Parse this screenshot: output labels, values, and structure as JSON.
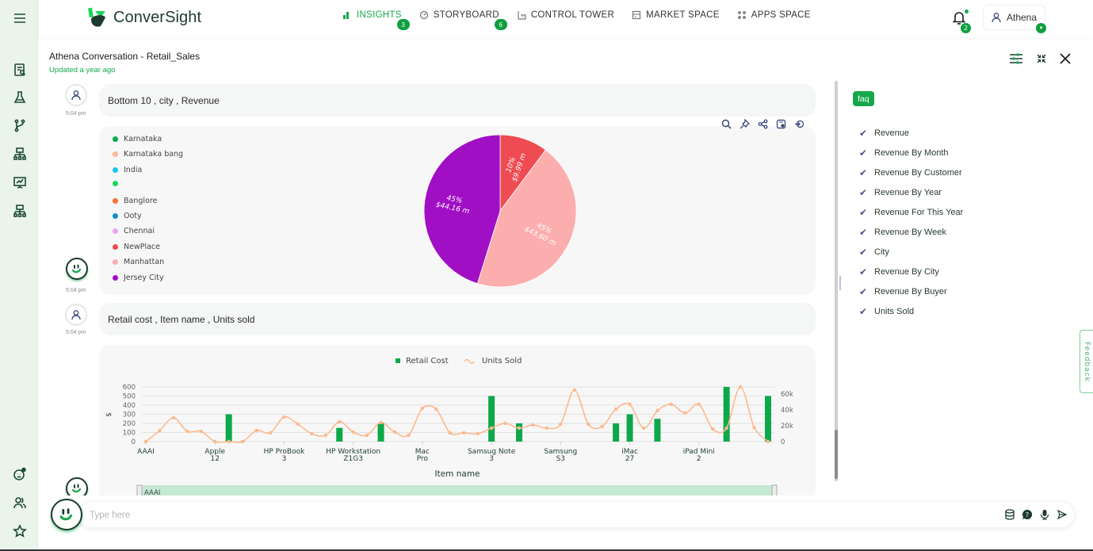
{
  "app": {
    "brand": "ConverSight",
    "brand_colors": {
      "primary": "#14a84b",
      "dark": "#1d3b2e"
    }
  },
  "nav": [
    {
      "label": "INSIGHTS",
      "icon": "bar-chart-icon",
      "badge": "3",
      "active": true
    },
    {
      "label": "STORYBOARD",
      "icon": "gauge-icon",
      "badge": "6",
      "active": false
    },
    {
      "label": "CONTROL TOWER",
      "icon": "tower-icon",
      "badge": null,
      "active": false
    },
    {
      "label": "MARKET SPACE",
      "icon": "store-icon",
      "badge": null,
      "active": false
    },
    {
      "label": "APPS SPACE",
      "icon": "apps-grid-icon",
      "badge": null,
      "active": false
    }
  ],
  "notifications": {
    "count": "2"
  },
  "user": {
    "name": "Athena"
  },
  "sidebar": {
    "top_icons": [
      "report-search-icon",
      "flask-icon",
      "branch-icon",
      "hierarchy-icon",
      "presentation-chart-icon",
      "org-chart-icon"
    ],
    "bottom_icons": [
      "bot-settings-icon",
      "users-icon",
      "star-icon"
    ]
  },
  "conversation": {
    "title": "Athena Conversation - Retail_Sales",
    "updated": "Updated a year ago"
  },
  "messages": [
    {
      "type": "user",
      "text": "Bottom 10 , city , Revenue",
      "time": "5:04 pm"
    },
    {
      "type": "bot",
      "time": "5:04 pm",
      "chart": "pie"
    },
    {
      "type": "user",
      "text": "Retail cost , Item name , Units sold",
      "time": "5:04 pm"
    },
    {
      "type": "bot",
      "time": "",
      "chart": "combo"
    }
  ],
  "chart_tools": [
    "search-icon",
    "pin-icon",
    "share-icon",
    "save-icon",
    "export-icon"
  ],
  "chart_data": [
    {
      "type": "pie",
      "title": "Bottom 10, city, Revenue",
      "legend_position": "left",
      "legend": [
        {
          "label": "Karnataka",
          "color": "#0da849"
        },
        {
          "label": "Karnataka bang",
          "color": "#fdb98f"
        },
        {
          "label": "India",
          "color": "#1cc2f5"
        },
        {
          "label": "",
          "color": "#18d858"
        },
        {
          "label": "Banglore",
          "color": "#fb7230"
        },
        {
          "label": "Ooty",
          "color": "#0a94c8"
        },
        {
          "label": "Chennai",
          "color": "#eda3f3"
        },
        {
          "label": "NewPlace",
          "color": "#ef4b52"
        },
        {
          "label": "Manhattan",
          "color": "#fbaead"
        },
        {
          "label": "Jersey City",
          "color": "#a00fc4"
        }
      ],
      "slices": [
        {
          "label": "NewPlace",
          "value": 9.99,
          "percent": "10%",
          "value_label": "$9.99 m",
          "color": "#ef4b52"
        },
        {
          "label": "Manhattan",
          "value": 43.6,
          "percent": "45%",
          "value_label": "$43.60 m",
          "color": "#fbaead"
        },
        {
          "label": "Jersey City",
          "value": 44.16,
          "percent": "45%",
          "value_label": "$44.16 m",
          "color": "#a00fc4"
        }
      ]
    },
    {
      "type": "bar",
      "subtype": "bar+line",
      "xlabel": "Item name",
      "ylabel": "$",
      "ylim": [
        0,
        600
      ],
      "y_ticks": [
        "0",
        "100",
        "200",
        "300",
        "400",
        "500",
        "600"
      ],
      "y2lim": [
        0,
        60000
      ],
      "y2_ticks": [
        "0",
        "20k",
        "40k",
        "60k"
      ],
      "grid": true,
      "legend_position": "top",
      "legend": [
        {
          "label": "Retail Cost",
          "color": "#0da849",
          "kind": "bar"
        },
        {
          "label": "Units Sold",
          "color": "#fdb98f",
          "kind": "line"
        }
      ],
      "x_tick_labels": [
        {
          "index": 0,
          "line1": "AAAI",
          "line2": ""
        },
        {
          "index": 5,
          "line1": "Apple",
          "line2": "12"
        },
        {
          "index": 10,
          "line1": "HP ProBook",
          "line2": "3"
        },
        {
          "index": 15,
          "line1": "HP Workstation",
          "line2": "Z1G3"
        },
        {
          "index": 20,
          "line1": "Mac",
          "line2": "Pro"
        },
        {
          "index": 25,
          "line1": "Samsug Note",
          "line2": "3"
        },
        {
          "index": 30,
          "line1": "Samsung",
          "line2": "S3"
        },
        {
          "index": 35,
          "line1": "iMac",
          "line2": "27"
        },
        {
          "index": 40,
          "line1": "iPad Mini",
          "line2": "2"
        }
      ],
      "point_count": 46,
      "series": [
        {
          "name": "Retail Cost",
          "axis": "left",
          "bars": [
            {
              "index": 6,
              "value": 300
            },
            {
              "index": 14,
              "value": 150
            },
            {
              "index": 17,
              "value": 200
            },
            {
              "index": 25,
              "value": 500
            },
            {
              "index": 27,
              "value": 200
            },
            {
              "index": 34,
              "value": 200
            },
            {
              "index": 35,
              "value": 300
            },
            {
              "index": 37,
              "value": 250
            },
            {
              "index": 42,
              "value": 600
            },
            {
              "index": 45,
              "value": 500
            }
          ]
        },
        {
          "name": "Units Sold",
          "axis": "right",
          "values": [
            0,
            14000,
            30000,
            13000,
            13000,
            0,
            0,
            0,
            14000,
            11000,
            31000,
            22000,
            10000,
            8000,
            25000,
            12000,
            8000,
            24000,
            12000,
            8000,
            42000,
            41000,
            11000,
            11000,
            10000,
            17000,
            23000,
            17000,
            21000,
            17000,
            22000,
            65000,
            22000,
            19000,
            41000,
            47000,
            17000,
            39000,
            47000,
            36000,
            47000,
            16000,
            17000,
            69000,
            18000,
            0
          ]
        }
      ],
      "zoom_slider": {
        "start_label": "AAAI",
        "range": [
          0,
          1
        ]
      }
    }
  ],
  "faq": {
    "tag": "faq",
    "items": [
      "Revenue",
      "Revenue By Month",
      "Revenue By Customer",
      "Revenue By Year",
      "Revenue For This Year",
      "Revenue By Week",
      "City",
      "Revenue By City",
      "Revenue By Buyer",
      "Units Sold"
    ]
  },
  "feedback_label": "Feedback",
  "input": {
    "placeholder": "Type here",
    "value": ""
  },
  "input_tools": [
    "database-icon",
    "help-chat-icon",
    "microphone-icon",
    "send-icon"
  ]
}
